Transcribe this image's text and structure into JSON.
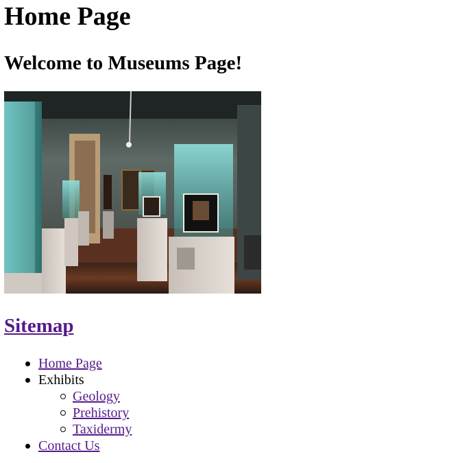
{
  "page": {
    "title": "Home Page",
    "welcome": "Welcome to Museums Page!"
  },
  "hero_image": {
    "icon": "museum-gallery-photo",
    "colors": {
      "wall": "#5e6a66",
      "floor": "#4a2a1c",
      "glass": "#7fd3cf",
      "pedestal": "#d6cfc8"
    }
  },
  "sitemap": {
    "heading": "Sitemap",
    "items": [
      {
        "label": "Home Page"
      },
      {
        "label": "Exhibits",
        "children": [
          {
            "label": "Geology"
          },
          {
            "label": "Prehistory"
          },
          {
            "label": "Taxidermy"
          }
        ]
      },
      {
        "label": "Contact Us"
      }
    ]
  },
  "colors": {
    "link": "#551a8b",
    "text": "#000000"
  }
}
